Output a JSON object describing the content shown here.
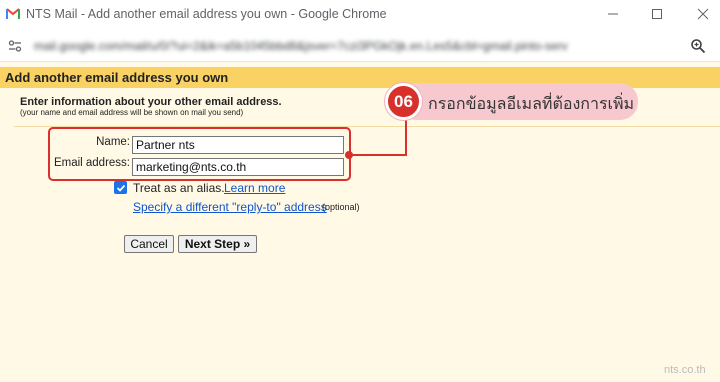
{
  "window": {
    "title": "NTS Mail - Add another email address you own - Google Chrome",
    "url": "mail.google.com/mail/u/0/?ui=2&ik=a5b1045bbd8&jsver=7czi3PGkOjk.en.Les5&cbl=gmail.pinto-serv"
  },
  "page": {
    "heading": "Add another email address you own",
    "intro": "Enter information about your other email address.",
    "intro_sub": "(your name and email address will be shown on mail you send)"
  },
  "form": {
    "name_label": "Name:",
    "name_value": "Partner nts",
    "email_label": "Email address:",
    "email_value": "marketing@nts.co.th",
    "alias_label": "Treat as an alias.",
    "alias_checked": true,
    "learn_more": "Learn more",
    "reply_to_link": "Specify a different \"reply-to\" address",
    "optional": "(optional)",
    "cancel_label": "Cancel",
    "next_label": "Next Step »"
  },
  "callout": {
    "number": "06",
    "text": "กรอกข้อมูลอีเมลที่ต้องการเพิ่ม"
  },
  "watermark": "nts.co.th",
  "colors": {
    "heading_band": "#fad163",
    "page_bg": "#fff9e6",
    "accent_red": "#d9302c",
    "callout_bg": "#f7c9cf",
    "link": "#1155cc"
  }
}
